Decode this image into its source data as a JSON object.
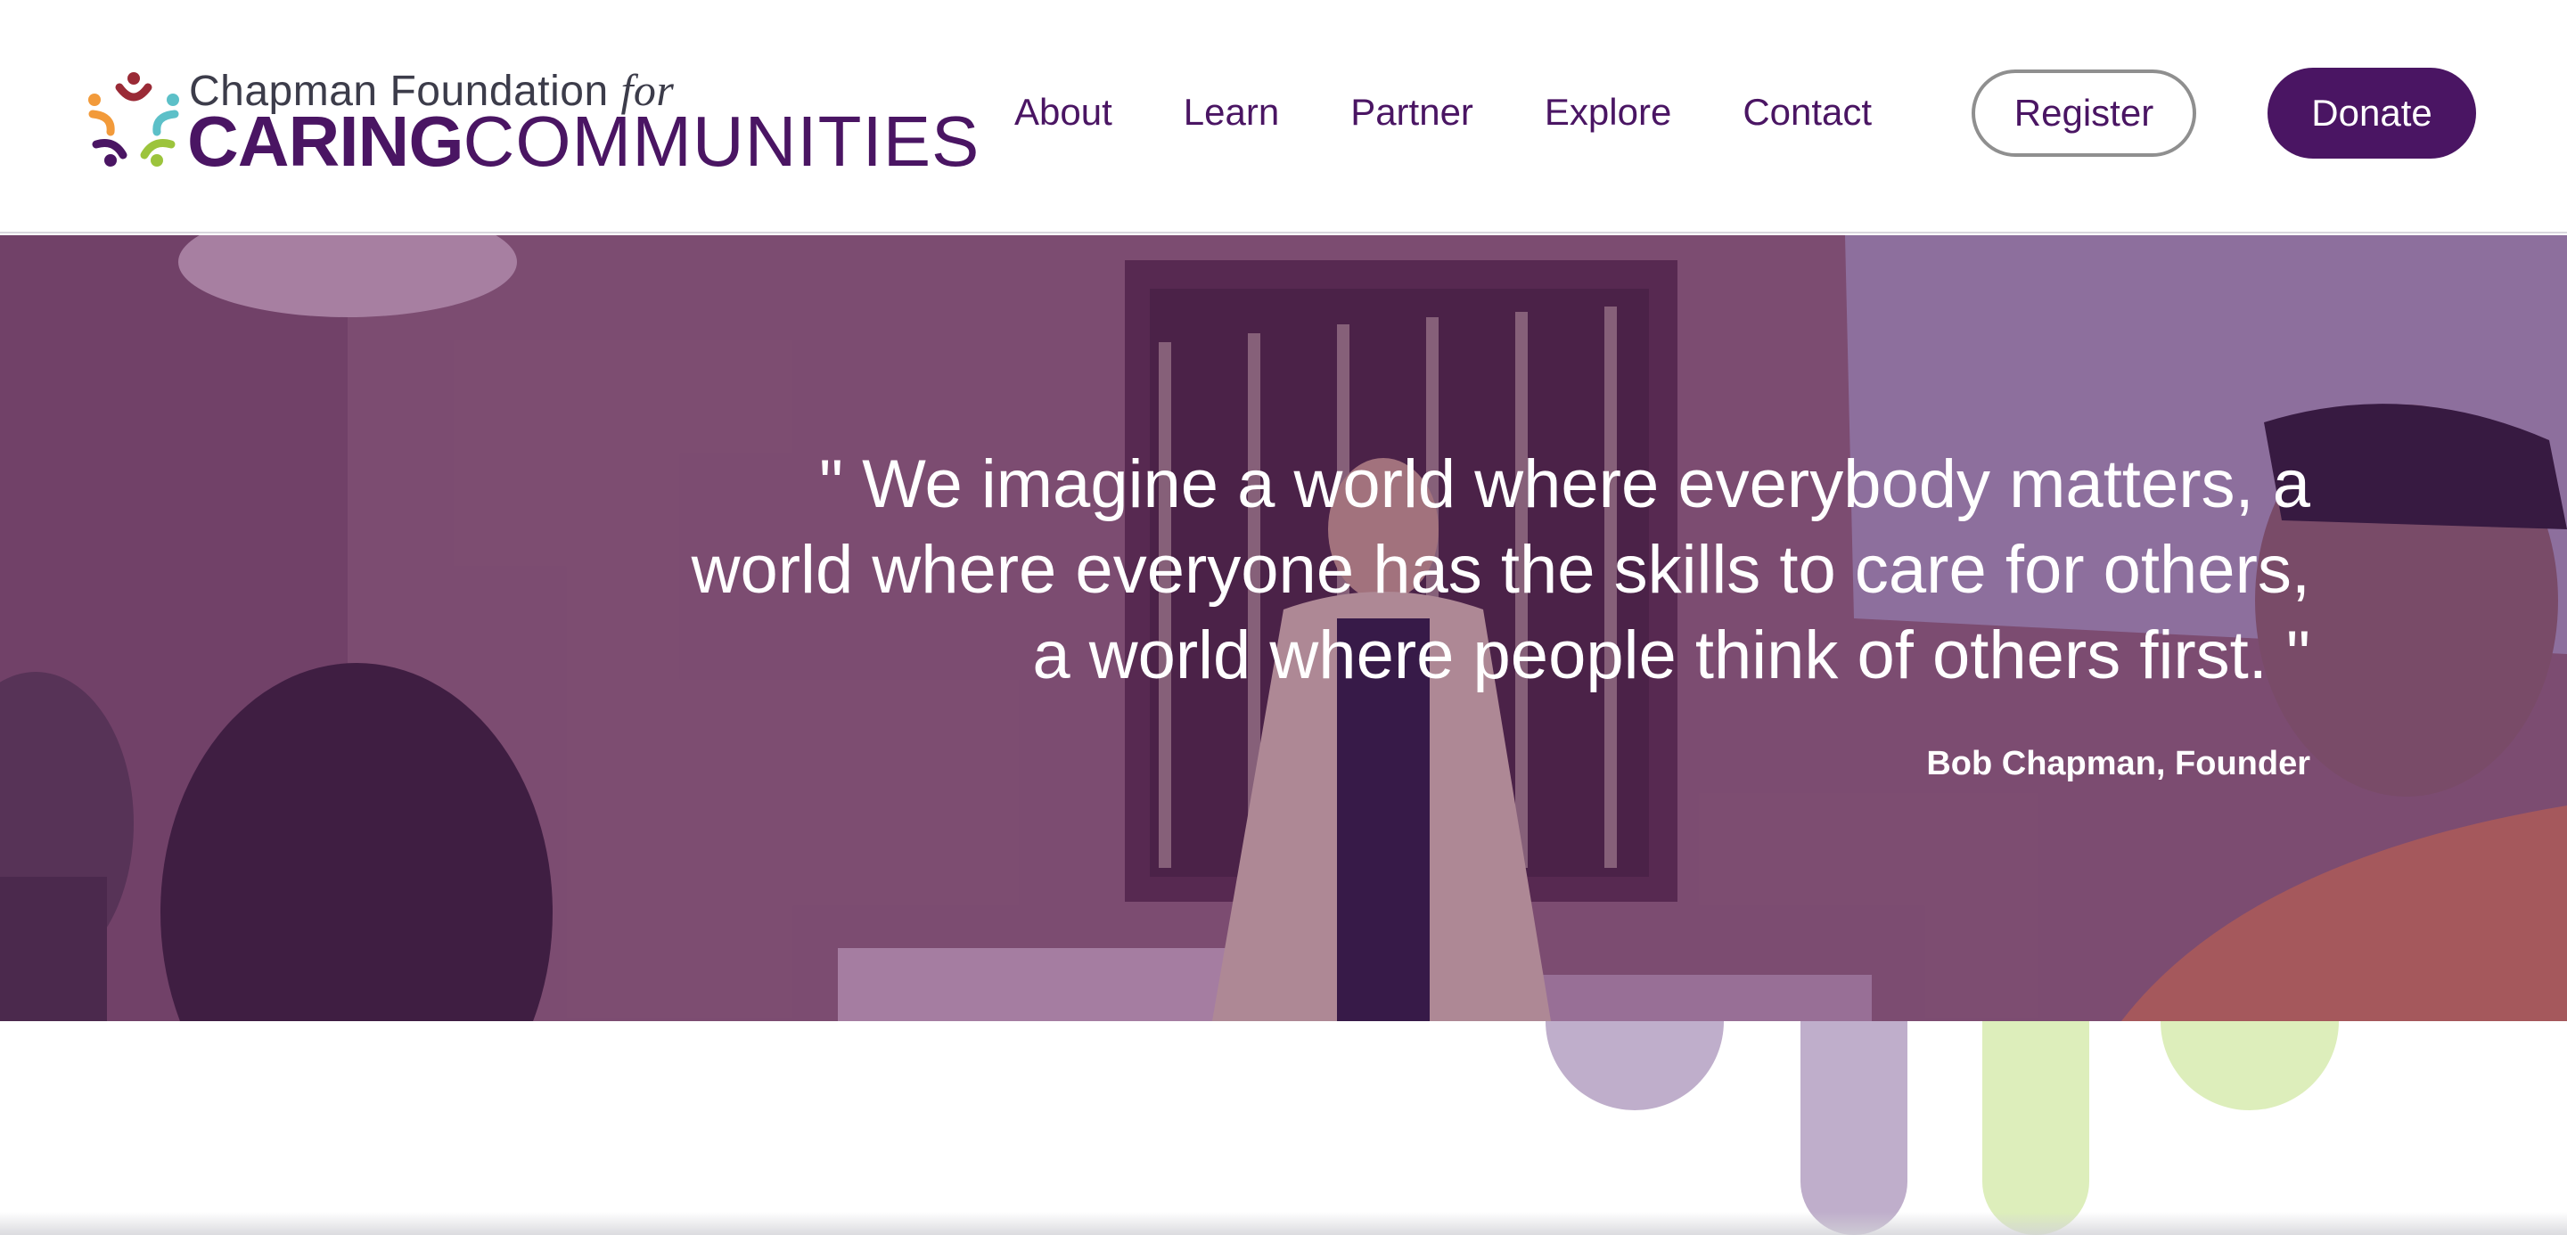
{
  "header": {
    "logo": {
      "line1": "Chapman Foundation",
      "line1_italic": "for",
      "line2_bold": "CARING",
      "line2_regular": "COMMUNITIES"
    },
    "nav": [
      {
        "label": "About"
      },
      {
        "label": "Learn"
      },
      {
        "label": "Partner"
      },
      {
        "label": "Explore"
      },
      {
        "label": "Contact"
      }
    ],
    "register_label": "Register",
    "donate_label": "Donate"
  },
  "hero": {
    "quote": "\" We imagine a world where everybody matters, a world where everyone has the skills to care for others, a world where people think of others first. \"",
    "attribution": "Bob Chapman, Founder"
  },
  "colors": {
    "brand_purple": "#4a1563",
    "light_purple": "#bfaecb",
    "light_green": "#ddeebb",
    "logo_red": "#9a2a36",
    "logo_orange": "#f29a3a",
    "logo_teal": "#5cc0c8",
    "logo_lime": "#9cc43c"
  }
}
